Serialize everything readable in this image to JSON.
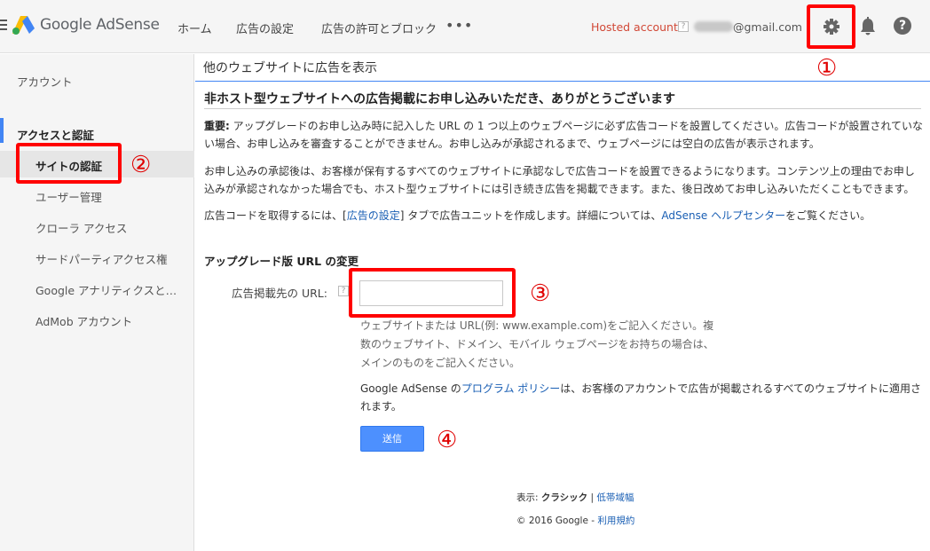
{
  "header": {
    "brand": "Google AdSense",
    "nav": [
      "ホーム",
      "広告の設定",
      "広告の許可とブロック"
    ],
    "more": "•••",
    "account_type": "Hosted account",
    "help_mark": "?",
    "email_suffix": "@gmail.com",
    "help_icon": "?"
  },
  "annotations": {
    "n1": "①",
    "n2": "②",
    "n3": "③",
    "n4": "④",
    "color": "#ff0000"
  },
  "sidebar": {
    "account": "アカウント",
    "section": "アクセスと認証",
    "items": [
      "サイトの認証",
      "ユーザー管理",
      "クローラ アクセス",
      "サードパーティアクセス権",
      "Google アナリティクスとの...",
      "AdMob アカウント"
    ]
  },
  "main": {
    "page_title": "他のウェブサイトに広告を表示",
    "heading": "非ホスト型ウェブサイトへの広告掲載にお申し込みいただき、ありがとうございます",
    "p1_bold": "重要:",
    "p1": " アップグレードのお申し込み時に記入した URL の 1 つ以上のウェブページに必ず広告コードを設置してください。広告コードが設置されていない場合、お申し込みを審査することができません。お申し込みが承認されるまで、ウェブページには空白の広告が表示されます。",
    "p2": "お申し込みの承認後は、お客様が保有するすべてのウェブサイトに承認なしで広告コードを設置できるようになります。コンテンツ上の理由でお申し込みが承認されなかった場合でも、ホスト型ウェブサイトには引き続き広告を掲載できます。また、後日改めてお申し込みいただくこともできます。",
    "p3_a": "広告コードを取得するには、[",
    "p3_link1": "広告の設定",
    "p3_b": "] タブで広告ユニットを作成します。詳細については、",
    "p3_link2": "AdSense ヘルプセンター",
    "p3_c": "をご覧ください。",
    "section_title": "アップグレード版 URL の変更",
    "field_label": "広告掲載先の URL:",
    "field_help": "?",
    "url_value": "",
    "hint": "ウェブサイトまたは URL(例: www.example.com)をご記入ください。複数のウェブサイト、ドメイン、モバイル ウェブページをお持ちの場合は、メインのものをご記入ください。",
    "policy_a": "Google AdSense の",
    "policy_link": "プログラム ポリシー",
    "policy_b": "は、お客様のアカウントで広告が掲載されるすべてのウェブサイトに適用されます。",
    "submit": "送信"
  },
  "footer": {
    "display_label": "表示: ",
    "display_classic": "クラシック",
    "sep": " | ",
    "low_bandwidth": "低帯域幅",
    "copyright": "© 2016 Google - ",
    "terms": "利用規約"
  }
}
